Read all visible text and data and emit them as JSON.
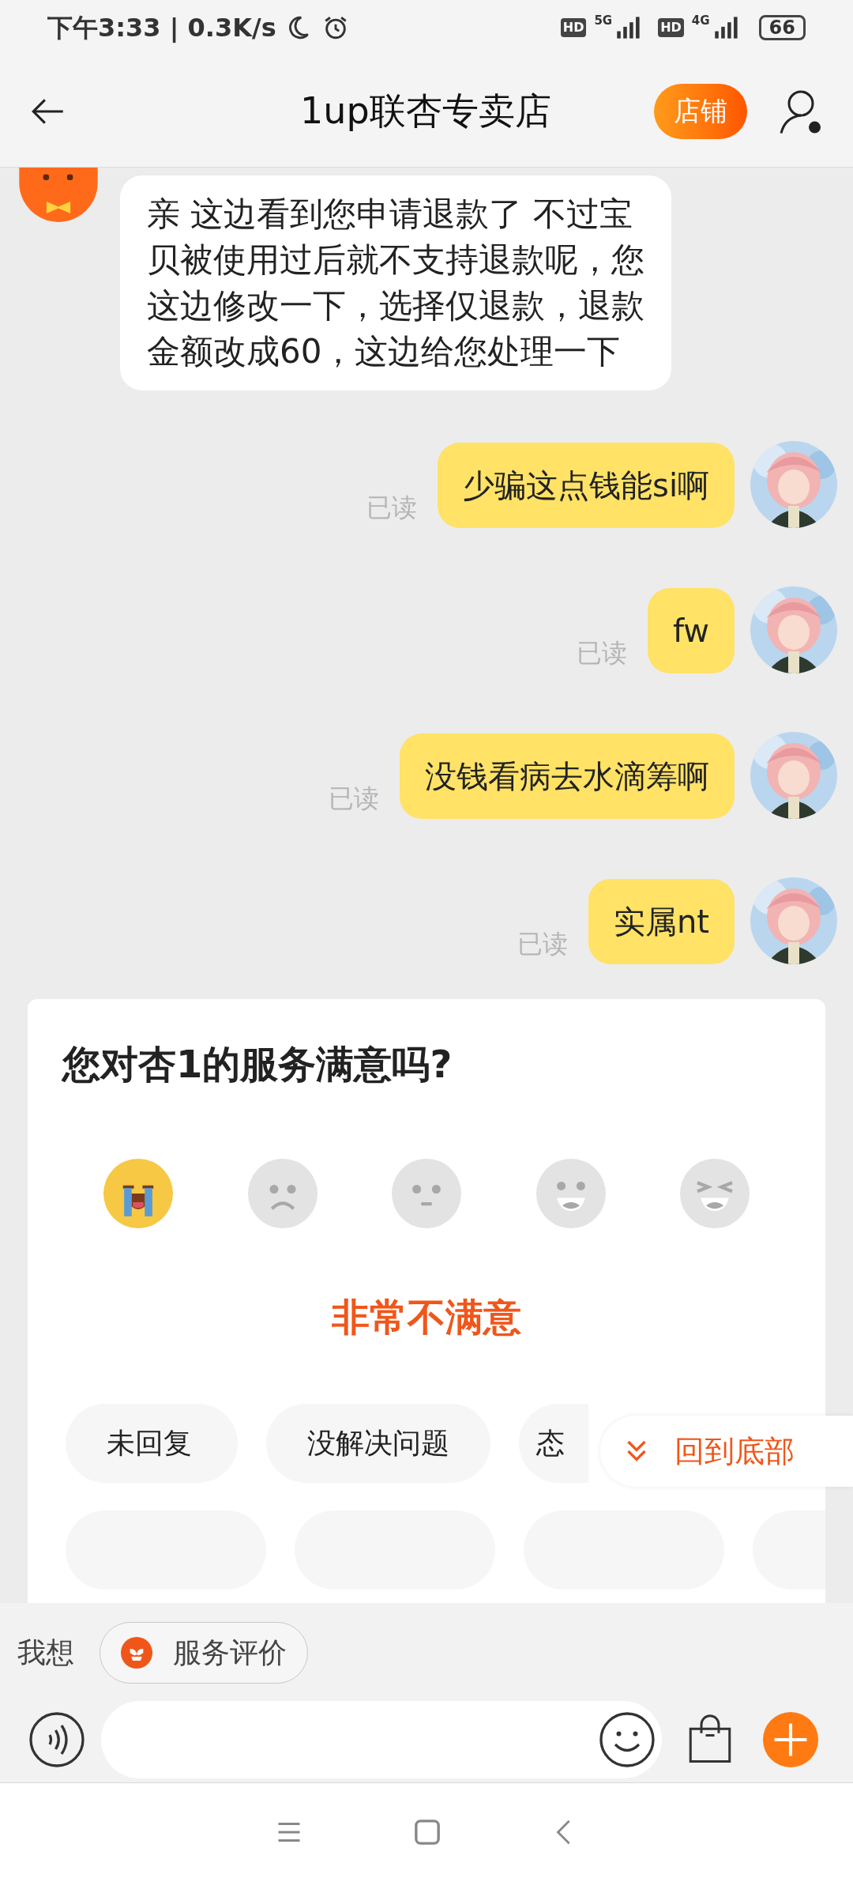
{
  "status_bar": {
    "time": "下午3:33 | 0.3K/s",
    "network_1": "5G",
    "network_2": "4G",
    "battery": "66",
    "hd_1": "HD",
    "hd_2": "HD"
  },
  "header": {
    "title": "1up联杏专卖店",
    "shop_button": "店铺"
  },
  "messages": [
    {
      "kind": "seller",
      "text": "亲 这边看到您申请退款了  不过宝贝被使用过后就不支持退款呢，您这边修改一下，选择仅退款，退款金额改成60，这边给您处理一下"
    },
    {
      "kind": "me",
      "text": "少骗这点钱能si啊",
      "read_label": "已读"
    },
    {
      "kind": "me",
      "text": "fw",
      "read_label": "已读"
    },
    {
      "kind": "me",
      "text": "没钱看病去水滴筹啊",
      "read_label": "已读"
    },
    {
      "kind": "me",
      "text": "实属nt",
      "read_label": "已读"
    }
  ],
  "rating_card": {
    "question": "您对杏1的服务满意吗?",
    "options": [
      {
        "kind": "crying",
        "selected": true
      },
      {
        "kind": "angry",
        "selected": false
      },
      {
        "kind": "neutral",
        "selected": false
      },
      {
        "kind": "smile",
        "selected": false
      },
      {
        "kind": "laugh",
        "selected": false
      }
    ],
    "result": "非常不满意",
    "tags": [
      "未回复",
      "没解决问题",
      "态"
    ]
  },
  "scroll_to_bottom": "回到底部",
  "quick_bar": {
    "label": "我想",
    "chip": "服务评价"
  }
}
